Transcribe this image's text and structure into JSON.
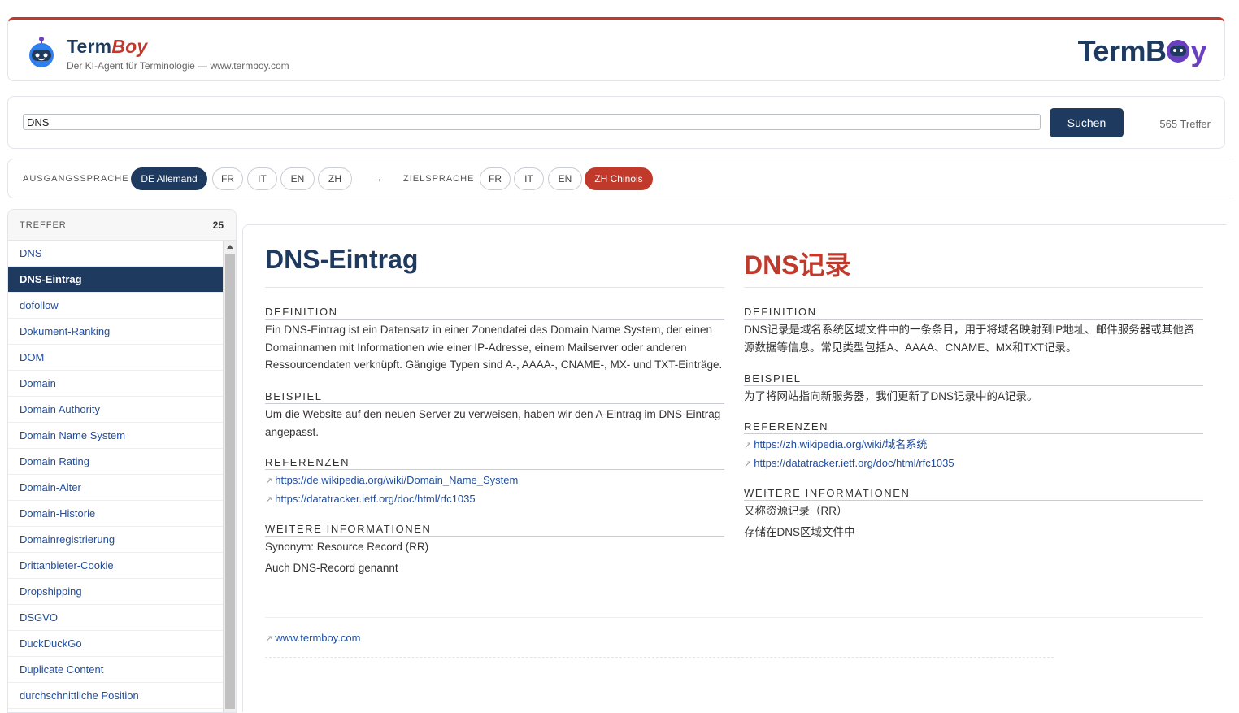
{
  "header": {
    "brand_term": "Term",
    "brand_boy": "Boy",
    "tagline": "Der KI-Agent für Terminologie — www.termboy.com",
    "logo_right_a": "TermB",
    "logo_right_b": "y"
  },
  "search": {
    "value": "DNS",
    "button_label": "Suchen",
    "hits": "565 Treffer"
  },
  "languages": {
    "source_label": "AUSGANGSSPRACHE",
    "source_options": [
      "DE Allemand",
      "FR",
      "IT",
      "EN",
      "ZH"
    ],
    "source_selected": "DE Allemand",
    "arrow": "→",
    "target_label": "ZIELSPRACHE",
    "target_options": [
      "FR",
      "IT",
      "EN",
      "ZH Chinois"
    ],
    "target_selected": "ZH Chinois"
  },
  "sidebar": {
    "title": "TREFFER",
    "count": "25",
    "items": [
      "DNS",
      "DNS-Eintrag",
      "dofollow",
      "Dokument-Ranking",
      "DOM",
      "Domain",
      "Domain Authority",
      "Domain Name System",
      "Domain Rating",
      "Domain-Alter",
      "Domain-Historie",
      "Domainregistrierung",
      "Drittanbieter-Cookie",
      "Dropshipping",
      "DSGVO",
      "DuckDuckGo",
      "Duplicate Content",
      "durchschnittliche Position"
    ],
    "selected": "DNS-Eintrag"
  },
  "entry_de": {
    "title": "DNS-Eintrag",
    "definition_label": "DEFINITION",
    "definition": "Ein DNS-Eintrag ist ein Datensatz in einer Zonendatei des Domain Name System, der einen Domainnamen mit Informationen wie einer IP-Adresse, einem Mailserver oder anderen Ressourcendaten verknüpft. Gängige Typen sind A-, AAAA-, CNAME-, MX- und TXT-Einträge.",
    "example_label": "BEISPIEL",
    "example": "Um die Website auf den neuen Server zu verweisen, haben wir den A-Eintrag im DNS-Eintrag angepasst.",
    "references_label": "REFERENZEN",
    "references": [
      "https://de.wikipedia.org/wiki/Domain_Name_System",
      "https://datatracker.ietf.org/doc/html/rfc1035"
    ],
    "info_label": "WEITERE INFORMATIONEN",
    "info": [
      "Synonym: Resource Record (RR)",
      "Auch DNS-Record genannt"
    ]
  },
  "entry_zh": {
    "title": "DNS记录",
    "definition_label": "DEFINITION",
    "definition": "DNS记录是域名系统区域文件中的一条条目，用于将域名映射到IP地址、邮件服务器或其他资源数据等信息。常见类型包括A、AAAA、CNAME、MX和TXT记录。",
    "example_label": "BEISPIEL",
    "example": "为了将网站指向新服务器，我们更新了DNS记录中的A记录。",
    "references_label": "REFERENZEN",
    "references": [
      "https://zh.wikipedia.org/wiki/域名系统",
      "https://datatracker.ietf.org/doc/html/rfc1035"
    ],
    "info_label": "WEITERE INFORMATIONEN",
    "info": [
      "又称资源记录（RR）",
      "存储在DNS区域文件中"
    ]
  },
  "footer": {
    "link": "www.termboy.com"
  },
  "colors": {
    "navy": "#1f3a5f",
    "red": "#c0392b",
    "link": "#1f4ea3"
  }
}
